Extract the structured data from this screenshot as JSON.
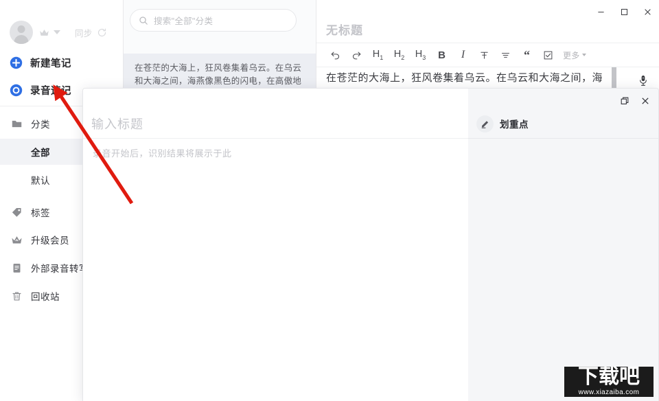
{
  "app": {
    "accent_color": "#2f6fe4",
    "selected_bg": "#f2f3f6",
    "list_bg": "#fafbfc",
    "note_selected_bg": "#eceef3",
    "panel_bg": "#f5f6f8",
    "annotation_color": "#e01b0f"
  },
  "sidebar": {
    "account": {
      "avatar_icon": "avatar-icon",
      "crown_icon": "crown-icon",
      "chevron_icon": "chevron-down-icon",
      "sync_label": "同步",
      "sync_icon": "sync-refresh-icon"
    },
    "actions": [
      {
        "label": "新建笔记",
        "icon": "plus-circle-icon"
      },
      {
        "label": "录音速记",
        "icon": "record-circle-icon"
      }
    ],
    "nav": [
      {
        "label": "分类",
        "icon": "folder-icon",
        "selected": false,
        "sub": false
      },
      {
        "label": "全部",
        "icon": "",
        "selected": true,
        "sub": true
      },
      {
        "label": "默认",
        "icon": "",
        "selected": false,
        "sub": true
      },
      {
        "label": "标签",
        "icon": "tag-icon",
        "selected": false,
        "sub": false
      },
      {
        "label": "升级会员",
        "icon": "crown-icon",
        "selected": false,
        "sub": false
      },
      {
        "label": "外部录音转写",
        "icon": "document-icon",
        "selected": false,
        "sub": false
      },
      {
        "label": "回收站",
        "icon": "trash-icon",
        "selected": false,
        "sub": false
      }
    ]
  },
  "note_list": {
    "search": {
      "placeholder": "搜索\"全部\"分类",
      "value": "",
      "icon": "search-icon"
    },
    "items": [
      {
        "snippet": "在苍茫的大海上，狂风卷集着乌云。在乌云和大海之间，海燕像黑色的闪电，在高傲地飞...",
        "selected": true
      }
    ]
  },
  "editor": {
    "window_controls": [
      {
        "name": "minimize",
        "icon": "minimize-icon"
      },
      {
        "name": "maximize",
        "icon": "maximize-icon"
      },
      {
        "name": "close",
        "icon": "close-icon"
      }
    ],
    "title": "无标题",
    "toolbar": [
      {
        "label": "",
        "icon": "undo-icon"
      },
      {
        "label": "",
        "icon": "redo-icon"
      },
      {
        "label": "H1",
        "icon": "heading-1-icon"
      },
      {
        "label": "H2",
        "icon": "heading-2-icon"
      },
      {
        "label": "H3",
        "icon": "heading-3-icon"
      },
      {
        "label": "B",
        "icon": "bold-icon"
      },
      {
        "label": "I",
        "icon": "italic-icon"
      },
      {
        "label": "",
        "icon": "strikethrough-icon"
      },
      {
        "label": "",
        "icon": "align-icon"
      },
      {
        "label": "",
        "icon": "quote-icon"
      },
      {
        "label": "",
        "icon": "checkbox-icon"
      }
    ],
    "more_label": "更多",
    "body_text": "在苍茫的大海上，狂风卷集着乌云。在乌云和大海之间，海",
    "mic_icon": "microphone-icon"
  },
  "modal": {
    "controls": [
      {
        "name": "restore",
        "icon": "restore-window-icon"
      },
      {
        "name": "close",
        "icon": "close-icon"
      }
    ],
    "title_placeholder": "输入标题",
    "title_value": "",
    "transcript_hint": "录音开始后，识别结果将展示于此",
    "right_panel": {
      "label": "划重点",
      "icon": "pencil-icon"
    }
  },
  "watermark": {
    "text": "下载吧",
    "url": "www.xiazaiba.com"
  }
}
